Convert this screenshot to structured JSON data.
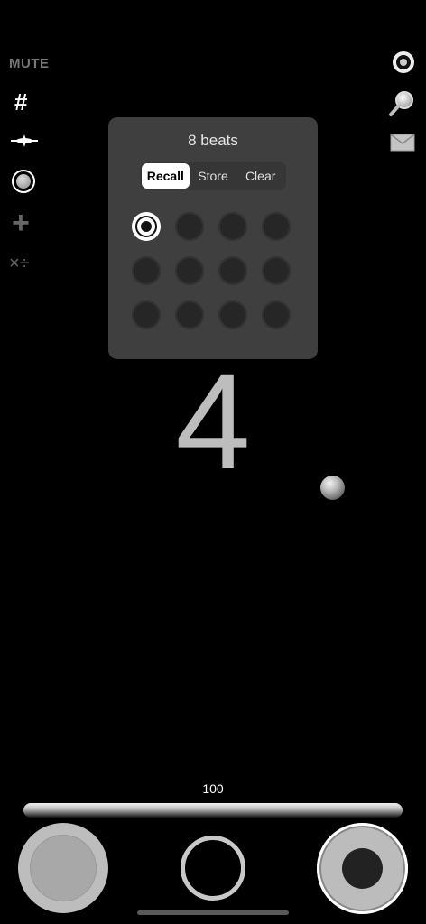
{
  "left_toolbar": {
    "mute_label": "MUTE",
    "hash_label": "#",
    "tuner_icon": "tuner-icon",
    "record_icon": "record-icon",
    "plus_label": "+",
    "math_label": "×÷"
  },
  "right_toolbar": {
    "record_icon": "record-icon",
    "search_icon": "magnifier-icon",
    "mail_icon": "mail-icon"
  },
  "preset_popup": {
    "title": "8 beats",
    "segments": [
      {
        "label": "Recall",
        "active": true
      },
      {
        "label": "Store",
        "active": false
      },
      {
        "label": "Clear",
        "active": false
      }
    ],
    "slots": [
      {
        "on": true
      },
      {
        "on": false
      },
      {
        "on": false
      },
      {
        "on": false
      },
      {
        "on": false
      },
      {
        "on": false
      },
      {
        "on": false
      },
      {
        "on": false
      },
      {
        "on": false
      },
      {
        "on": false
      },
      {
        "on": false
      },
      {
        "on": false
      }
    ]
  },
  "beat_display": {
    "number": "4"
  },
  "tempo": {
    "value": "100"
  },
  "colors": {
    "background": "#000000",
    "popup": "#3f3f3f",
    "accent": "#bdbdbd"
  }
}
